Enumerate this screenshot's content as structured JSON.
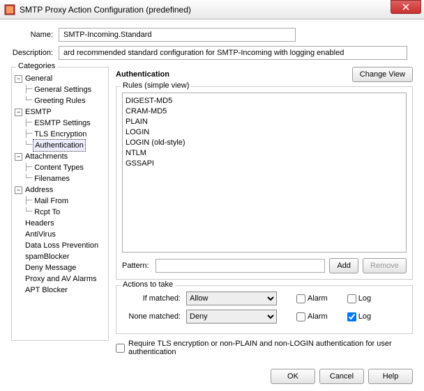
{
  "window": {
    "title": "SMTP Proxy Action Configuration (predefined)"
  },
  "header": {
    "name_label": "Name:",
    "name_value": "SMTP-Incoming.Standard",
    "desc_label": "Description:",
    "desc_value": "ard recommended standard configuration for SMTP-Incoming with logging enabled"
  },
  "categories": {
    "legend": "Categories",
    "tree": {
      "general": {
        "label": "General",
        "children": {
          "gs": "General Settings",
          "gr": "Greeting Rules"
        }
      },
      "esmtp": {
        "label": "ESMTP",
        "children": {
          "es": "ESMTP Settings",
          "tls": "TLS Encryption",
          "auth": "Authentication"
        }
      },
      "attach": {
        "label": "Attachments",
        "children": {
          "ct": "Content Types",
          "fn": "Filenames"
        }
      },
      "address": {
        "label": "Address",
        "children": {
          "mf": "Mail From",
          "rt": "Rcpt To"
        }
      },
      "headers": "Headers",
      "antivirus": "AntiVirus",
      "dlp": "Data Loss Prevention",
      "spam": "spamBlocker",
      "deny": "Deny Message",
      "proxy": "Proxy and AV Alarms",
      "apt": "APT Blocker"
    }
  },
  "right": {
    "title": "Authentication",
    "change_view": "Change View",
    "rules_legend": "Rules (simple view)",
    "rules": {
      "r0": "DIGEST-MD5",
      "r1": "CRAM-MD5",
      "r2": "PLAIN",
      "r3": "LOGIN",
      "r4": "LOGIN (old-style)",
      "r5": "NTLM",
      "r6": "GSSAPI"
    },
    "pattern_label": "Pattern:",
    "add": "Add",
    "remove": "Remove",
    "actions_legend": "Actions to take",
    "if_matched": "If matched:",
    "none_matched": "None matched:",
    "allow": "Allow",
    "deny": "Deny",
    "alarm": "Alarm",
    "log": "Log",
    "require": "Require TLS encryption or non-PLAIN and non-LOGIN authentication for user authentication"
  },
  "footer": {
    "ok": "OK",
    "cancel": "Cancel",
    "help": "Help"
  }
}
